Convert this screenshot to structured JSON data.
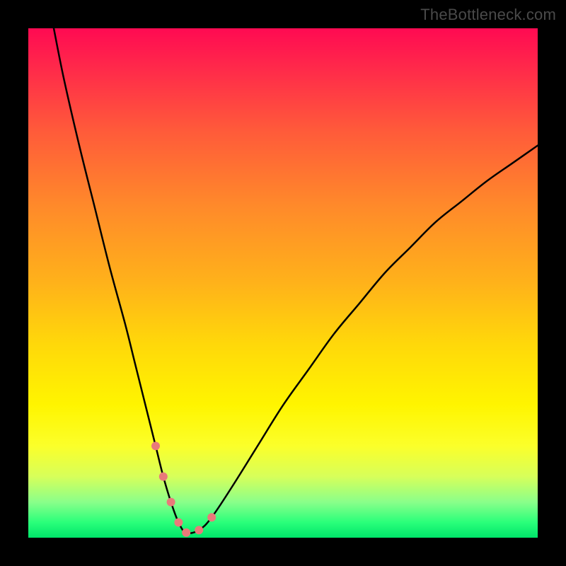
{
  "watermark": "TheBottleneck.com",
  "chart_data": {
    "type": "line",
    "title": "",
    "xlabel": "",
    "ylabel": "",
    "xlim": [
      0,
      100
    ],
    "ylim": [
      0,
      100
    ],
    "gradient_stops": [
      {
        "pct": 0,
        "color": "#ff0a52"
      },
      {
        "pct": 8,
        "color": "#ff2a4a"
      },
      {
        "pct": 20,
        "color": "#ff5a3a"
      },
      {
        "pct": 35,
        "color": "#ff8a2a"
      },
      {
        "pct": 50,
        "color": "#ffb21a"
      },
      {
        "pct": 62,
        "color": "#ffd80a"
      },
      {
        "pct": 74,
        "color": "#fff500"
      },
      {
        "pct": 82,
        "color": "#fbff2a"
      },
      {
        "pct": 88,
        "color": "#d7ff5a"
      },
      {
        "pct": 93,
        "color": "#8aff8a"
      },
      {
        "pct": 97,
        "color": "#2aff7a"
      },
      {
        "pct": 100,
        "color": "#00e56a"
      }
    ],
    "series": [
      {
        "name": "curve",
        "type": "line",
        "color": "#000000",
        "x": [
          5,
          7,
          10,
          13,
          16,
          19,
          21,
          23,
          25,
          26.5,
          28,
          29.5,
          31,
          33.5,
          36,
          40,
          45,
          50,
          55,
          60,
          65,
          70,
          75,
          80,
          85,
          90,
          95,
          100
        ],
        "values": [
          100,
          90,
          77,
          65,
          53,
          42,
          34,
          26,
          18,
          12,
          7,
          3,
          1,
          1.5,
          4,
          10,
          18,
          26,
          33,
          40,
          46,
          52,
          57,
          62,
          66,
          70,
          73.5,
          77
        ]
      },
      {
        "name": "markers",
        "type": "scatter",
        "color": "#e97a7a",
        "x": [
          25,
          26.5,
          28,
          29.5,
          31,
          33.5,
          36
        ],
        "values": [
          18,
          12,
          7,
          3,
          1,
          1.5,
          4
        ],
        "marker_radius": 6
      }
    ]
  }
}
